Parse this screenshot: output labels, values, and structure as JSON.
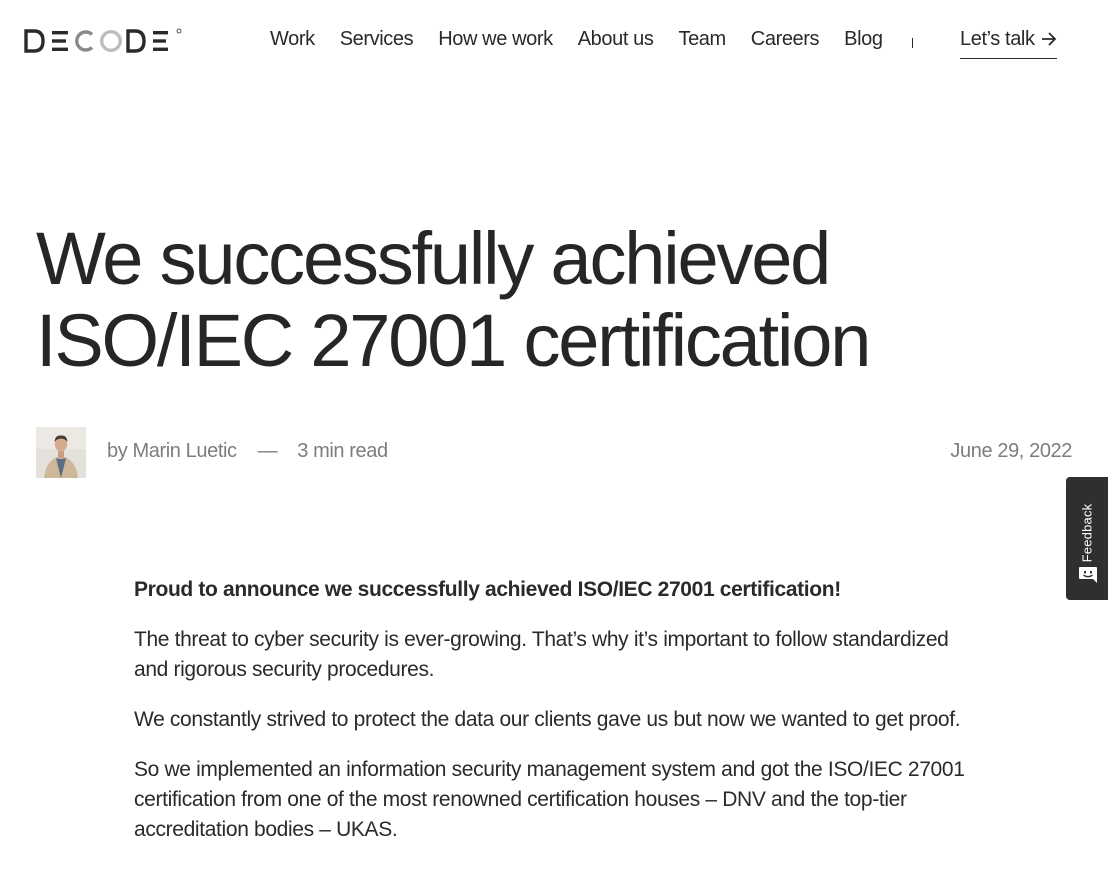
{
  "header": {
    "logo_text": "DECODE",
    "nav": [
      "Work",
      "Services",
      "How we work",
      "About us",
      "Team",
      "Careers",
      "Blog"
    ],
    "cta_label": "Let’s talk"
  },
  "article": {
    "title": "We successfully achieved ISO/IEC 27001 certification",
    "author": "by Marin Luetic",
    "separator": "—",
    "read_time": "3 min read",
    "date": "June 29, 2022",
    "paragraphs": [
      "Proud to announce we successfully achieved ISO/IEC 27001 certification!",
      "The threat to cyber security is ever-growing. That’s why it’s important to follow standardized and rigorous security procedures.",
      "We constantly strived to protect the data our clients gave us but now we wanted to get proof.",
      "So we implemented an information security management system and got the ISO/IEC 27001 certification from one of the most renowned certification houses – DNV and the top-tier accreditation bodies – UKAS."
    ]
  },
  "feedback": {
    "label": "Feedback",
    "icon": "smiley-chat-icon"
  },
  "icons": {
    "cta_arrow": "arrow-right-icon"
  },
  "colors": {
    "text": "#2a2a2a",
    "muted": "#7d7d7d",
    "feedback_bg": "#2f2f2f"
  }
}
